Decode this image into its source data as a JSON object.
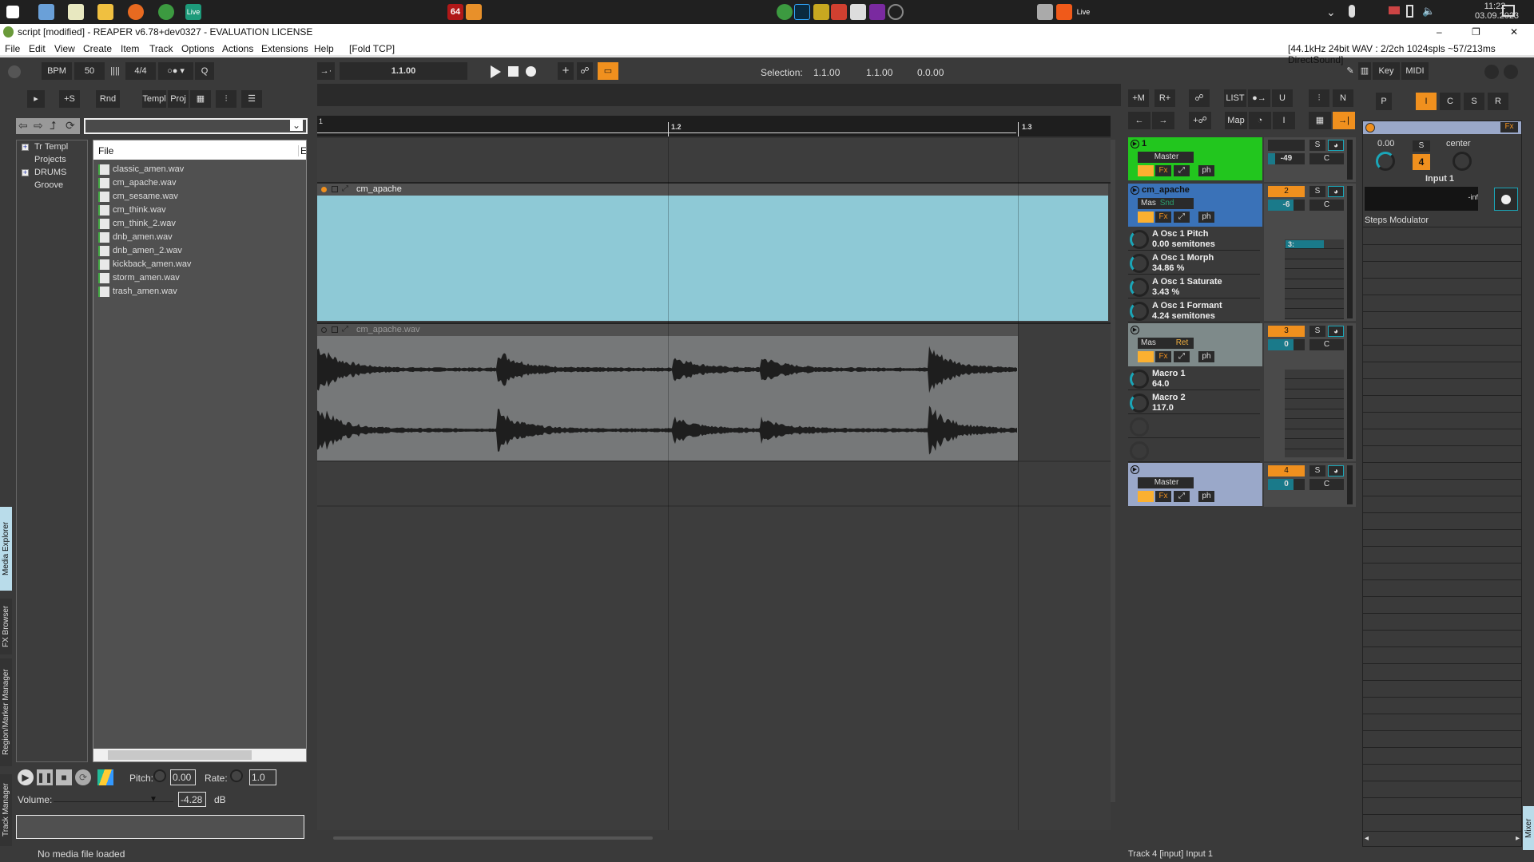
{
  "taskbar": {
    "app_badge": "64",
    "live_label": "Live",
    "live_label2": "Live",
    "time": "11:22",
    "date": "03.09.2023"
  },
  "window": {
    "title": "script [modified] - REAPER v6.78+dev0327 - EVALUATION LICENSE",
    "minimize": "–",
    "restore": "❐",
    "close": "✕"
  },
  "menu": {
    "items": [
      "File",
      "Edit",
      "View",
      "Create",
      "Item",
      "Track",
      "Options",
      "Actions",
      "Extensions",
      "Help",
      "[Fold TCP]"
    ],
    "audio_status": "[44.1kHz 24bit WAV : 2/2ch 1024spls ~57/213ms DirectSound]"
  },
  "toolbar": {
    "bpm_label": "BPM",
    "bpm": "50",
    "tap": "||||",
    "timesig": "4/4",
    "metro": "○● ▾",
    "quant": "Q",
    "position": "1.1.00",
    "selection_label": "Selection:",
    "sel_start": "1.1.00",
    "sel_end": "1.1.00",
    "sel_len": "0.0.00",
    "key": "Key",
    "midi": "MIDI",
    "row2": [
      "+S",
      "Rnd",
      "Templ",
      "Proj"
    ],
    "tcp_buttons": [
      "+M",
      "R+",
      "LIST",
      "U",
      "N",
      "Map",
      "I"
    ],
    "pics": [
      "P",
      "I",
      "C",
      "S",
      "R"
    ]
  },
  "side_tabs": [
    "Media Explorer",
    "FX Browser",
    "Region/Marker Manager",
    "Track Manager"
  ],
  "media_explorer": {
    "tree": [
      "Tr Templ",
      "Projects",
      "DRUMS",
      "Groove"
    ],
    "column_file": "File",
    "column_2": "E",
    "files": [
      "classic_amen.wav",
      "cm_apache.wav",
      "cm_sesame.wav",
      "cm_think.wav",
      "cm_think_2.wav",
      "dnb_amen.wav",
      "dnb_amen_2.wav",
      "kickback_amen.wav",
      "storm_amen.wav",
      "trash_amen.wav"
    ],
    "pitch_label": "Pitch:",
    "pitch": "0.00",
    "rate_label": "Rate:",
    "rate": "1.0",
    "volume_label": "Volume:",
    "volume": "-4.28",
    "db": "dB",
    "status": "No media file loaded"
  },
  "ruler": [
    "1",
    "1.2",
    "1.3"
  ],
  "items": {
    "midi_item": "cm_apache",
    "audio_item": "cm_apache.wav",
    "midi_color": "#8ec9d6",
    "audio_color": "#767879"
  },
  "tracks": [
    {
      "name": "1",
      "route": "Master",
      "route2": "",
      "color": "#22c61e",
      "num": "",
      "vol": "-49",
      "pan": "C"
    },
    {
      "name": "cm_apache",
      "route": "Mas",
      "route2": "Snd",
      "color": "#3a72b8",
      "num": "2",
      "vol": "-6",
      "pan": "C",
      "params": [
        {
          "name": "A Osc 1 Pitch",
          "value": "0.00 semitones"
        },
        {
          "name": "A Osc 1 Morph",
          "value": "34.86 %"
        },
        {
          "name": "A Osc 1 Saturate",
          "value": "3.43 %"
        },
        {
          "name": "A Osc 1 Formant",
          "value": "4.24 semitones"
        }
      ],
      "slot": "3:"
    },
    {
      "name": "",
      "route": "Mas",
      "route2": "Ret",
      "color": "#7e8a8a",
      "num": "3",
      "vol": "0",
      "pan": "C",
      "params": [
        {
          "name": "Macro 1",
          "value": "64.0"
        },
        {
          "name": "Macro 2",
          "value": "117.0"
        }
      ]
    },
    {
      "name": "",
      "route": "Master",
      "route2": "",
      "color": "#9aa8c9",
      "num": "4",
      "vol": "0",
      "pan": "C"
    }
  ],
  "track_btns": {
    "fx": "Fx",
    "ph": "ph",
    "solo": "S"
  },
  "fx_panel": {
    "fx": "Fx",
    "vol": "0.00",
    "solo": "S",
    "num": "4",
    "pan": "center",
    "input": "Input 1",
    "meter": "-inf",
    "plugin": "Steps Modulator"
  },
  "status": "Track 4 [input] Input 1",
  "mixer_tab": "Mixer",
  "colors": {
    "accent": "#f0901e",
    "teal": "#1aa6b8",
    "bg": "#3a3a3a"
  }
}
